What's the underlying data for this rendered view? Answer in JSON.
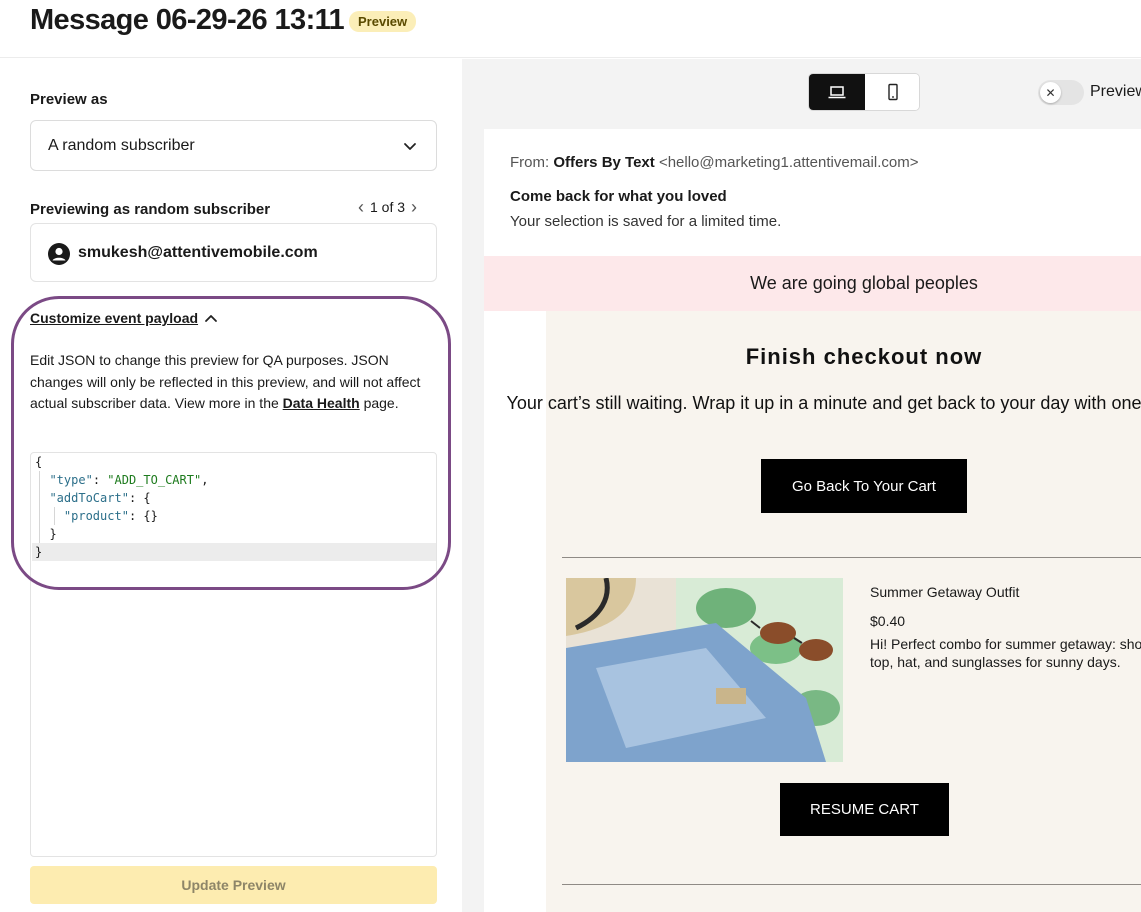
{
  "header": {
    "title": "Message 06-29-26 13:11",
    "badge": "Preview"
  },
  "left": {
    "preview_as_label": "Preview as",
    "select_value": "A random subscriber",
    "previewing_label": "Previewing as random subscriber",
    "pager": {
      "prev": "‹",
      "text": "1 of 3",
      "next": "›"
    },
    "subscriber_email": "smukesh@attentivemobile.com",
    "customize_label": "Customize event payload",
    "help_text_before": "Edit JSON to change this preview for QA purposes. JSON changes will only be reflected in this preview, and will not affect actual subscriber data. View more in the ",
    "help_link": "Data Health",
    "help_text_after": " page.",
    "json": {
      "open_brace": "{",
      "type_key": "\"type\"",
      "type_value": "\"ADD_TO_CART\"",
      "add_key": "\"addToCart\"",
      "product_key": "\"product\"",
      "product_value": "{}",
      "inner_close": "}",
      "close_brace": "}"
    },
    "update_button": "Update Preview"
  },
  "right": {
    "device_desktop_icon": "laptop-icon",
    "device_mobile_icon": "phone-icon",
    "preview_toggle_label": "Preview",
    "email": {
      "from_label": "From: ",
      "from_name": "Offers By Text",
      "from_address": "<hello@marketing1.attentivemail.com>",
      "subject": "Come back for what you loved",
      "preheader": "Your selection is saved for a limited time.",
      "banner": "We are going global peoples",
      "heading": "Finish checkout now",
      "copy": "Your cart’s still waiting. Wrap it up in a minute and get back to your day with one less task.",
      "cta_primary": "Go Back To Your Cart",
      "product_name": "Summer Getaway Outfit",
      "product_price": "$0.40",
      "product_desc": "Hi! Perfect combo for summer getaway: shorts, top, hat, and sunglasses for sunny days.",
      "cta_secondary": "RESUME CART"
    }
  },
  "colors": {
    "accent_ring": "#7b4a85",
    "badge_bg": "#fbeeb8",
    "update_button_bg": "#fdecb0",
    "banner_bg": "#fde8ea",
    "email_body_bg": "#f8f4ee"
  }
}
